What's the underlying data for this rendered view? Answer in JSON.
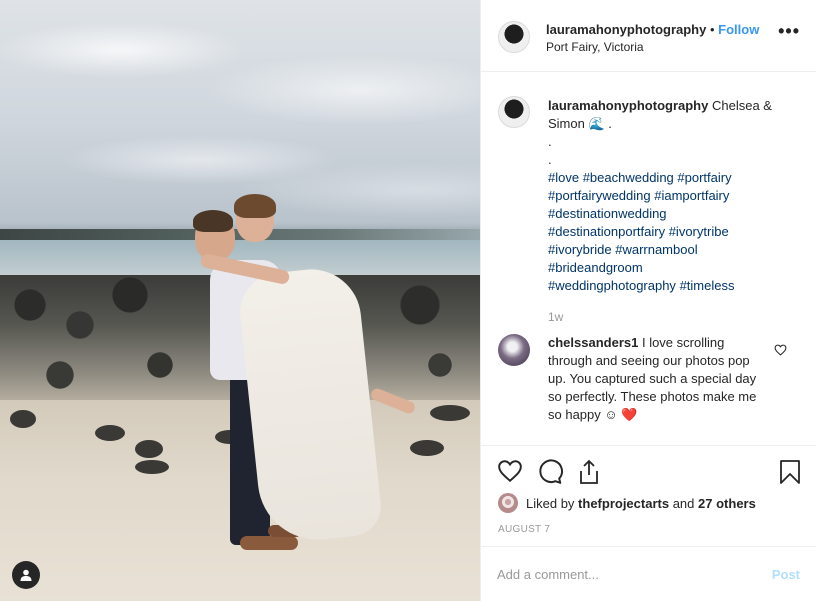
{
  "photo": {
    "alt_icon": "user-tag-icon"
  },
  "header": {
    "username": "laura​mahonyphotography",
    "separator": "•",
    "follow_label": "Follow",
    "location": "Port Fairy, Victoria",
    "more_icon": "more-options-icon",
    "more_label": "•••"
  },
  "caption": {
    "username": "laura​mahonyphotography",
    "text_before_emoji": "Chelsea & Simon",
    "emoji": "🌊",
    "text_after_emoji": ".",
    "line_dot1": ".",
    "line_dot2": ".",
    "hashtags": [
      "#love",
      "#beachwedding",
      "#portfairy",
      "#portfairywedding",
      "#iamportfairy",
      "#destinationwedding",
      "#destinationportfairy",
      "#ivorytribe",
      "#ivorybride",
      "#warrnambool",
      "#brideandgroom",
      "#weddingphotography",
      "#timeless"
    ],
    "time_ago": "1w"
  },
  "comment": {
    "username": "chelssanders1",
    "text": "I love scrolling through and seeing our photos pop up. You captured such a special day so perfectly. These photos make me so happy",
    "emoji_smile": "☺",
    "emoji_heart": "❤️",
    "like_icon": "heart-outline-icon"
  },
  "actions": {
    "like_icon": "heart-icon",
    "comment_icon": "comment-icon",
    "share_icon": "share-icon",
    "save_icon": "bookmark-icon",
    "liked_by_prefix": "Liked by",
    "liked_by_user": "thefprojectarts",
    "liked_by_and": "and",
    "liked_by_others": "27 others",
    "date": "AUGUST 7"
  },
  "add_comment": {
    "placeholder": "Add a comment...",
    "post_label": "Post"
  },
  "colors": {
    "link": "#003569",
    "follow": "#3897f0",
    "post_disabled": "#b2dffc",
    "muted": "#999999",
    "border": "#efefef"
  }
}
